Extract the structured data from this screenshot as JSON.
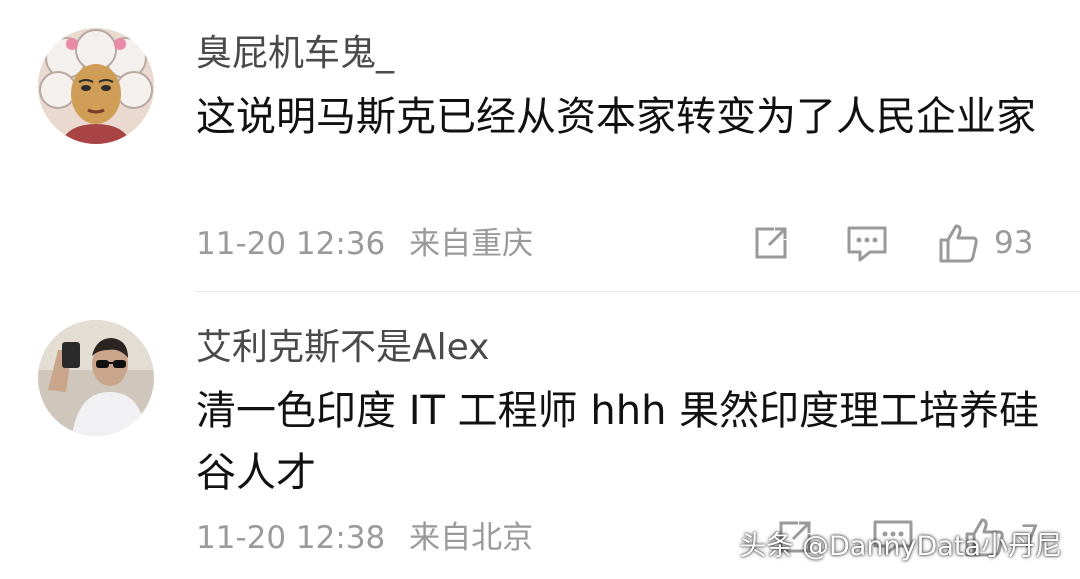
{
  "comments": [
    {
      "username": "臭屁机车鬼_",
      "text": "这说明马斯克已经从资本家转变为了人民企业家",
      "timestamp": "11-20 12:36",
      "location": "来自重庆",
      "likes": "93",
      "avatar_icon": "cartoon-woman-avatar"
    },
    {
      "username": "艾利克斯不是Alex",
      "text": "清一色印度 IT 工程师 hhh  果然印度理工培养硅谷人才",
      "timestamp": "11-20 12:38",
      "location": "来自北京",
      "likes": "7",
      "avatar_icon": "selfie-photo-avatar"
    }
  ],
  "watermark": "头条 @DannyData小丹尼",
  "colors": {
    "username": "#4a4a4a",
    "text": "#111111",
    "meta": "#9a9a9a",
    "icon": "#9a9a9a",
    "divider": "#e6e6e6"
  },
  "icons": {
    "share": "share-icon",
    "reply": "reply-icon",
    "like": "thumbs-up-icon"
  }
}
